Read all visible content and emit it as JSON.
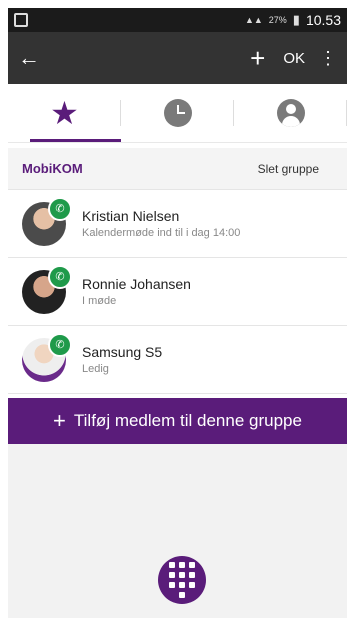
{
  "status_bar": {
    "time": "10.53",
    "battery": "27%"
  },
  "app_bar": {
    "back_icon": "arrow-left-icon",
    "add_icon": "plus-icon",
    "ok_label": "OK",
    "more_icon": "more-vert-icon"
  },
  "tabs": [
    {
      "icon": "star-icon",
      "active": true
    },
    {
      "icon": "clock-icon",
      "active": false
    },
    {
      "icon": "person-icon",
      "active": false
    }
  ],
  "group": {
    "name": "MobiKOM",
    "action_label": "Slet gruppe"
  },
  "members": [
    {
      "name": "Kristian Nielsen",
      "status": "Kalendermøde ind til i dag 14:00"
    },
    {
      "name": "Ronnie Johansen",
      "status": "I møde"
    },
    {
      "name": "Samsung S5",
      "status": "Ledig"
    }
  ],
  "add_member_label": "Tilføj medlem til denne gruppe",
  "colors": {
    "accent": "#5a1c7a",
    "appbar": "#333333",
    "available": "#1f9a4a"
  }
}
